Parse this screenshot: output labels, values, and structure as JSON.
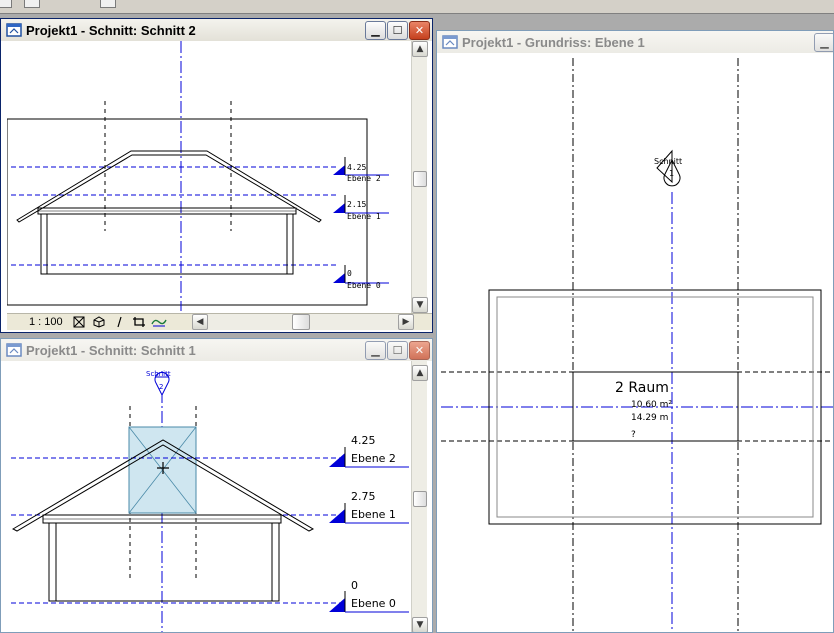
{
  "windows": {
    "schnitt2": {
      "title": "Projekt1 - Schnitt: Schnitt 2",
      "scale": "1 : 100"
    },
    "schnitt1": {
      "title": "Projekt1 - Schnitt: Schnitt 1"
    },
    "grundriss": {
      "title": "Projekt1 - Grundriss: Ebene 1"
    }
  },
  "levels": [
    {
      "elev": "4.25",
      "name": "Ebene 2"
    },
    {
      "elev": "2.75",
      "name": "Ebene 1"
    },
    {
      "elev": "0",
      "name": "Ebene 0"
    }
  ],
  "levels_small": [
    {
      "elev": "4.25",
      "name": "Ebene 2"
    },
    {
      "elev": "2.15",
      "name": "Ebene 1"
    },
    {
      "elev": "0",
      "name": "Ebene 0"
    }
  ],
  "section_marker": {
    "label": "Schnitt",
    "number": "1"
  },
  "section_marker_2": {
    "label": "Schnitt",
    "number": "2"
  },
  "room": {
    "name": "2 Raum",
    "area": "10.60 m²",
    "perimeter": "14.29 m",
    "unknown": "?"
  },
  "colors": {
    "annotation_blue": "#0000d8",
    "selection_fill": "#cfe6f0",
    "title_active": "#0a246a"
  }
}
